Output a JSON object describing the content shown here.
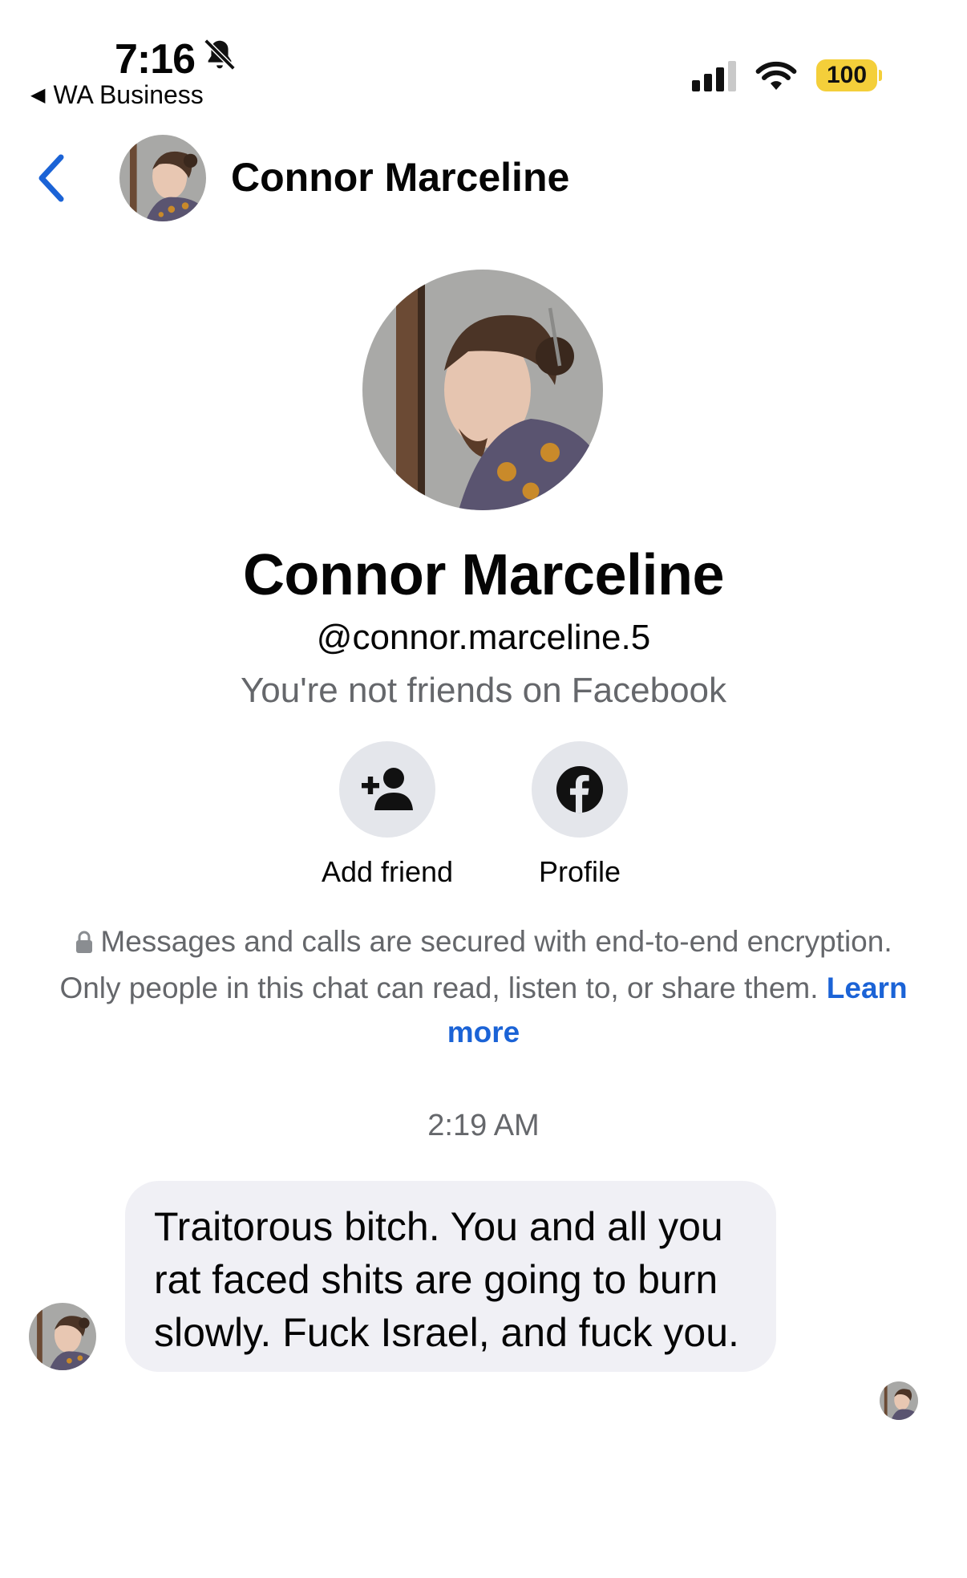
{
  "status_bar": {
    "time": "7:16",
    "back_app": "WA Business",
    "battery": "100",
    "icons": [
      "bell-slash-icon",
      "signal-icon",
      "wifi-icon",
      "battery-icon"
    ]
  },
  "header": {
    "name": "Connor Marceline",
    "icons": [
      "back-chevron-icon",
      "avatar"
    ]
  },
  "profile": {
    "name": "Connor Marceline",
    "handle": "@connor.marceline.5",
    "friend_status": "You're not friends on Facebook",
    "actions": [
      {
        "label": "Add friend",
        "icon": "add-friend-icon"
      },
      {
        "label": "Profile",
        "icon": "facebook-icon"
      }
    ]
  },
  "encryption": {
    "text": "Messages and calls are secured with end-to-end encryption. Only people in this chat can read, listen to, or share them.",
    "link": "Learn more"
  },
  "conversation": {
    "timestamp": "2:19 AM",
    "messages": [
      {
        "text": "Traitorous bitch. You and all you rat faced shits are going to burn slowly. Fuck Israel, and fuck you."
      }
    ]
  },
  "colors": {
    "accent": "#1b63d6",
    "bubble": "#f0f0f5",
    "secondary_text": "#65676b",
    "battery": "#f4cf3a",
    "action_circle": "#e4e6eb"
  }
}
